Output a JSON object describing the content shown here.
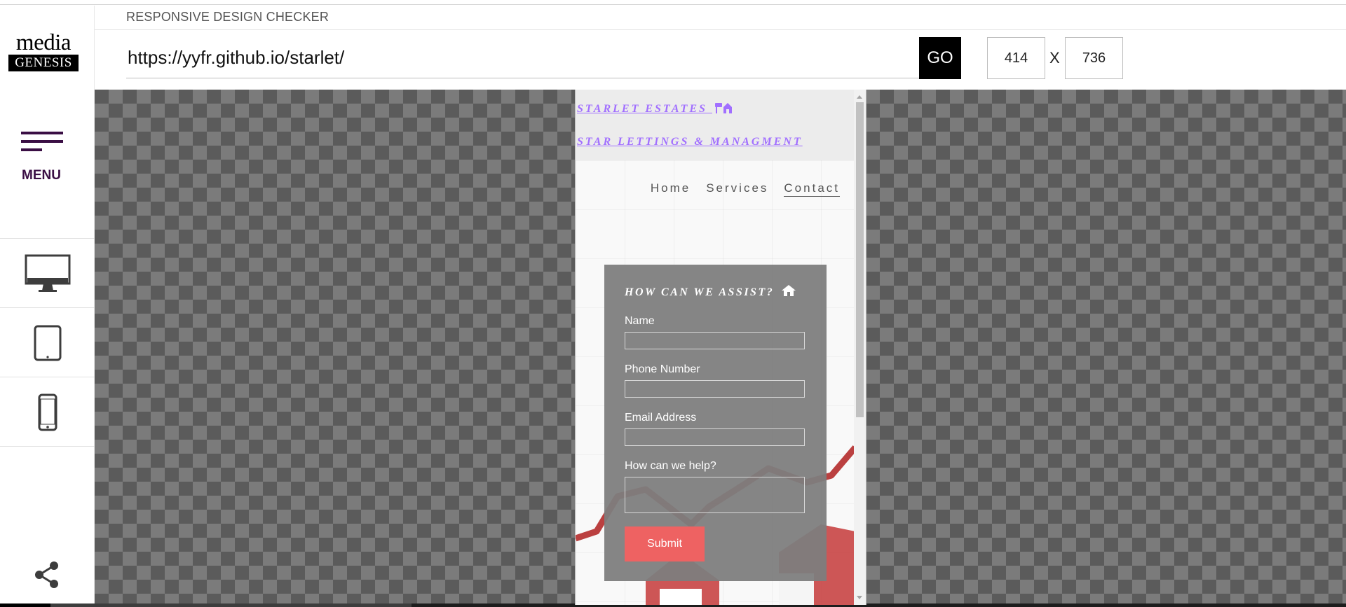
{
  "app": {
    "title": "RESPONSIVE DESIGN CHECKER",
    "url": "https://yyfr.github.io/starlet/",
    "go_label": "GO",
    "width": "414",
    "height": "736",
    "x_separator": "X"
  },
  "sidebar": {
    "logo_top": "media",
    "logo_bottom": "GENESIS",
    "menu_label": "MENU",
    "devices": [
      "desktop-icon",
      "tablet-icon",
      "phone-icon"
    ],
    "share": "share-icon"
  },
  "site": {
    "brand_line_1": "STARLET ESTATES",
    "brand_line_2": "STAR LETTINGS & MANAGMENT",
    "nav": [
      {
        "label": "Home",
        "active": false
      },
      {
        "label": "Services",
        "active": false
      },
      {
        "label": "Contact",
        "active": true
      }
    ],
    "form": {
      "title": "HOW CAN WE ASSIST?",
      "name_label": "Name",
      "phone_label": "Phone Number",
      "email_label": "Email Address",
      "help_label": "How can we help?",
      "submit_label": "Submit"
    }
  },
  "colors": {
    "brand_link": "#a16fff",
    "menu": "#3a0e44",
    "submit": "#ee6262",
    "go_button": "#000000"
  }
}
